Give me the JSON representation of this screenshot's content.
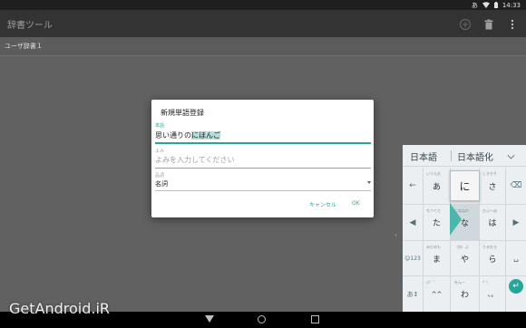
{
  "status_bar": {
    "notification_glyph": "あ",
    "time": "14:33"
  },
  "app_bar": {
    "title": "辞書ツール",
    "icons": [
      "add-icon",
      "delete-icon",
      "more-icon"
    ]
  },
  "dictionary_list": {
    "items": [
      {
        "label": "ユーザ辞書１"
      }
    ]
  },
  "dialog": {
    "title": "新規単語登録",
    "word": {
      "label": "単語",
      "value_prefix": "思い通りの",
      "value_composing": "にほんご"
    },
    "reading": {
      "label": "よみ",
      "placeholder": "よみを入力してください"
    },
    "part_of_speech": {
      "label": "品詞",
      "value": "名詞"
    },
    "cancel_label": "キャンセル",
    "ok_label": "OK"
  },
  "keyboard": {
    "candidates": [
      "日本語",
      "日本語化"
    ],
    "popup_char": "に",
    "rows": [
      {
        "left": "←",
        "keys": [
          {
            "main": "あ",
            "sub": "いうえお"
          },
          {
            "main": "か",
            "sub": "きくけこ"
          },
          {
            "main": "さ",
            "sub": "しすせそ"
          }
        ],
        "right": "⌫"
      },
      {
        "left": "◀",
        "keys": [
          {
            "main": "た",
            "sub": "ちつてと"
          },
          {
            "main": "な",
            "sub": "にぬねの"
          },
          {
            "main": "は",
            "sub": "ひふへほ"
          }
        ],
        "right": "▶"
      },
      {
        "left": "☺123",
        "keys": [
          {
            "main": "ま",
            "sub": "みむめも"
          },
          {
            "main": "や",
            "sub": "（ゆ）よ"
          },
          {
            "main": "ら",
            "sub": "りるれろ"
          }
        ],
        "right": "␣"
      },
      {
        "left": "あ↕",
        "keys": [
          {
            "main": "^^",
            "sub": "小゛゜"
          },
          {
            "main": "わ",
            "sub": "をんー"
          },
          {
            "main": "、。",
            "sub": "？！"
          }
        ],
        "right": "↵"
      }
    ]
  },
  "watermark": "GetAndroid.iR",
  "colors": {
    "accent": "#26a69a",
    "app_bar": "#333333",
    "background": "#616161",
    "keyboard": "#eceff1"
  }
}
